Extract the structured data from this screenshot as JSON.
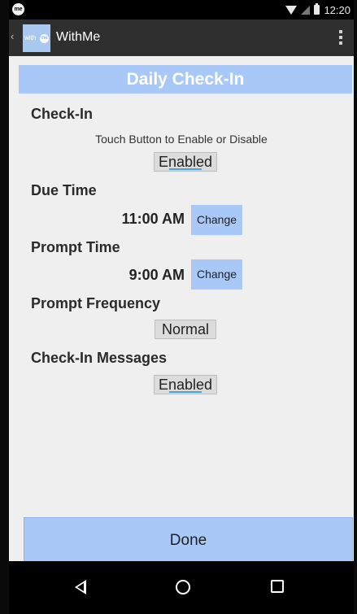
{
  "status_bar": {
    "app_badge": "me",
    "time": "12:20"
  },
  "action_bar": {
    "logo_small_text": "with",
    "logo_circle_text": "me",
    "title": "WithMe"
  },
  "screen": {
    "header": "Daily Check-In",
    "check_in": {
      "label": "Check-In",
      "hint": "Touch Button to Enable or Disable",
      "button": "Enabled"
    },
    "due_time": {
      "label": "Due Time",
      "value": "11:00 AM",
      "change": "Change"
    },
    "prompt_time": {
      "label": "Prompt Time",
      "value": "9:00 AM",
      "change": "Change"
    },
    "prompt_frequency": {
      "label": "Prompt Frequency",
      "button": "Normal"
    },
    "check_in_messages": {
      "label": "Check-In Messages",
      "button": "Enabled"
    },
    "done": "Done"
  },
  "colors": {
    "accent": "#a8c8f7",
    "action_bar": "#2f2f2f",
    "content_bg": "#efefef"
  },
  "icons": {
    "status": [
      "wifi-icon",
      "signal-icon",
      "battery-icon"
    ],
    "nav": [
      "back-icon",
      "home-icon",
      "recents-icon"
    ],
    "menu": "overflow-menu-icon"
  }
}
